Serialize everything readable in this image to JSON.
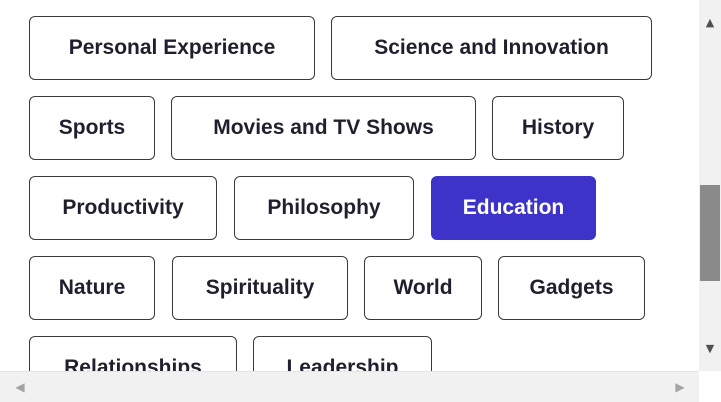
{
  "topics": [
    {
      "label": "Personal Experience",
      "selected": false
    },
    {
      "label": "Science and Innovation",
      "selected": false
    },
    {
      "label": "Sports",
      "selected": false
    },
    {
      "label": "Movies and TV Shows",
      "selected": false
    },
    {
      "label": "History",
      "selected": false
    },
    {
      "label": "Productivity",
      "selected": false
    },
    {
      "label": "Philosophy",
      "selected": false
    },
    {
      "label": "Education",
      "selected": true
    },
    {
      "label": "Nature",
      "selected": false
    },
    {
      "label": "Spirituality",
      "selected": false
    },
    {
      "label": "World",
      "selected": false
    },
    {
      "label": "Gadgets",
      "selected": false
    },
    {
      "label": "Relationships",
      "selected": false
    },
    {
      "label": "Leadership",
      "selected": false
    }
  ],
  "colors": {
    "selected_bg": "#3d33c9",
    "selected_text": "#ffffff",
    "chip_border": "#3a3a3a",
    "chip_text": "#1f1f2e"
  },
  "scrollbars": {
    "vertical": {
      "up_icon": "▲",
      "down_icon": "▼"
    },
    "horizontal": {
      "left_icon": "◀",
      "right_icon": "▶"
    }
  }
}
